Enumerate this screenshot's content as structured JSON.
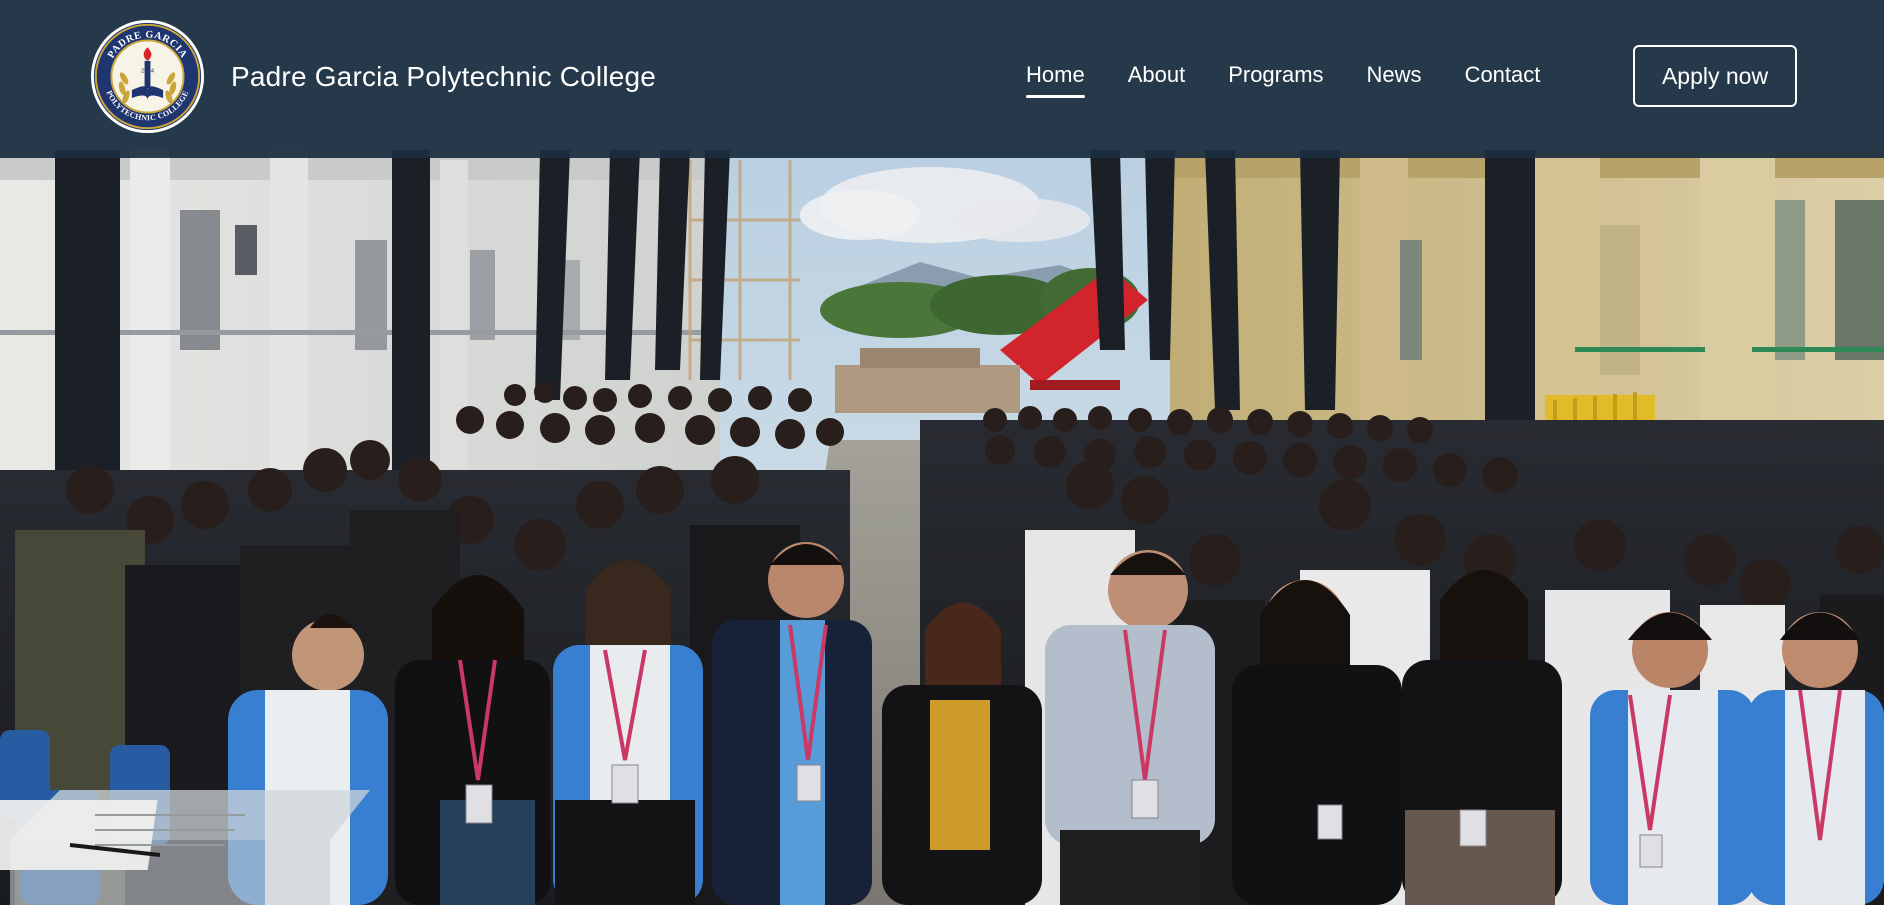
{
  "header": {
    "brand_name": "Padre Garcia Polytechnic College",
    "logo": {
      "ring_text_top": "PADRE GARCIA",
      "ring_text_bottom": "POLYTECHNIC COLLEGE",
      "year": "2024"
    },
    "nav": [
      {
        "label": "Home",
        "active": true
      },
      {
        "label": "About",
        "active": false
      },
      {
        "label": "Programs",
        "active": false
      },
      {
        "label": "News",
        "active": false
      },
      {
        "label": "Contact",
        "active": false
      }
    ],
    "apply_label": "Apply now"
  },
  "hero": {
    "image_icon": "group-photo",
    "colors": {
      "header_bg": "#1b2d40",
      "sky": "#cfe0ee",
      "building_left": "#e8e8e4",
      "building_right": "#d9c58e",
      "blue_uniform": "#2f7fd0",
      "red_shelter": "#d8262e"
    }
  }
}
